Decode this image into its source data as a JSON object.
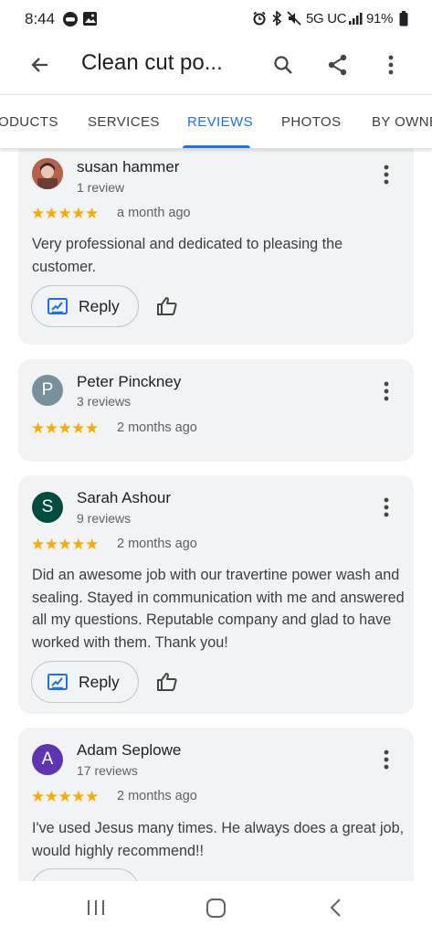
{
  "status_bar": {
    "time": "8:44",
    "network": "5G UC",
    "battery": "91%"
  },
  "app_bar": {
    "title": "Clean cut po..."
  },
  "tabs": [
    {
      "label": "ODUCTS"
    },
    {
      "label": "SERVICES"
    },
    {
      "label": "REVIEWS",
      "active": true
    },
    {
      "label": "PHOTOS"
    },
    {
      "label": "BY OWNE"
    }
  ],
  "reviews": [
    {
      "name": "susan hammer",
      "count": "1 review",
      "stars": "★★★★★",
      "time": "a month ago",
      "text": "Very professional and dedicated to pleasing the customer.",
      "reply_label": "Reply"
    },
    {
      "initial": "P",
      "avatar_color": "#78909c",
      "name": "Peter Pinckney",
      "count": "3 reviews",
      "stars": "★★★★★",
      "time": "2 months ago"
    },
    {
      "initial": "S",
      "avatar_color": "#004d40",
      "name": "Sarah Ashour",
      "count": "9 reviews",
      "stars": "★★★★★",
      "time": "2 months ago",
      "text": "Did an awesome job with our travertine power wash and sealing. Stayed in communication with me and answered all my questions. Reputable company and glad to have worked with them. Thank you!",
      "reply_label": "Reply"
    },
    {
      "initial": "A",
      "avatar_color": "#5e35b1",
      "name": "Adam Seplowe",
      "count": "17 reviews",
      "stars": "★★★★★",
      "time": "2 months ago",
      "text": "I've used Jesus many times. He always does a great job, would highly recommend!!"
    }
  ],
  "colors": {
    "accent": "#1a73e8",
    "star": "#f9ab00",
    "card_bg": "#f1f3f4"
  }
}
